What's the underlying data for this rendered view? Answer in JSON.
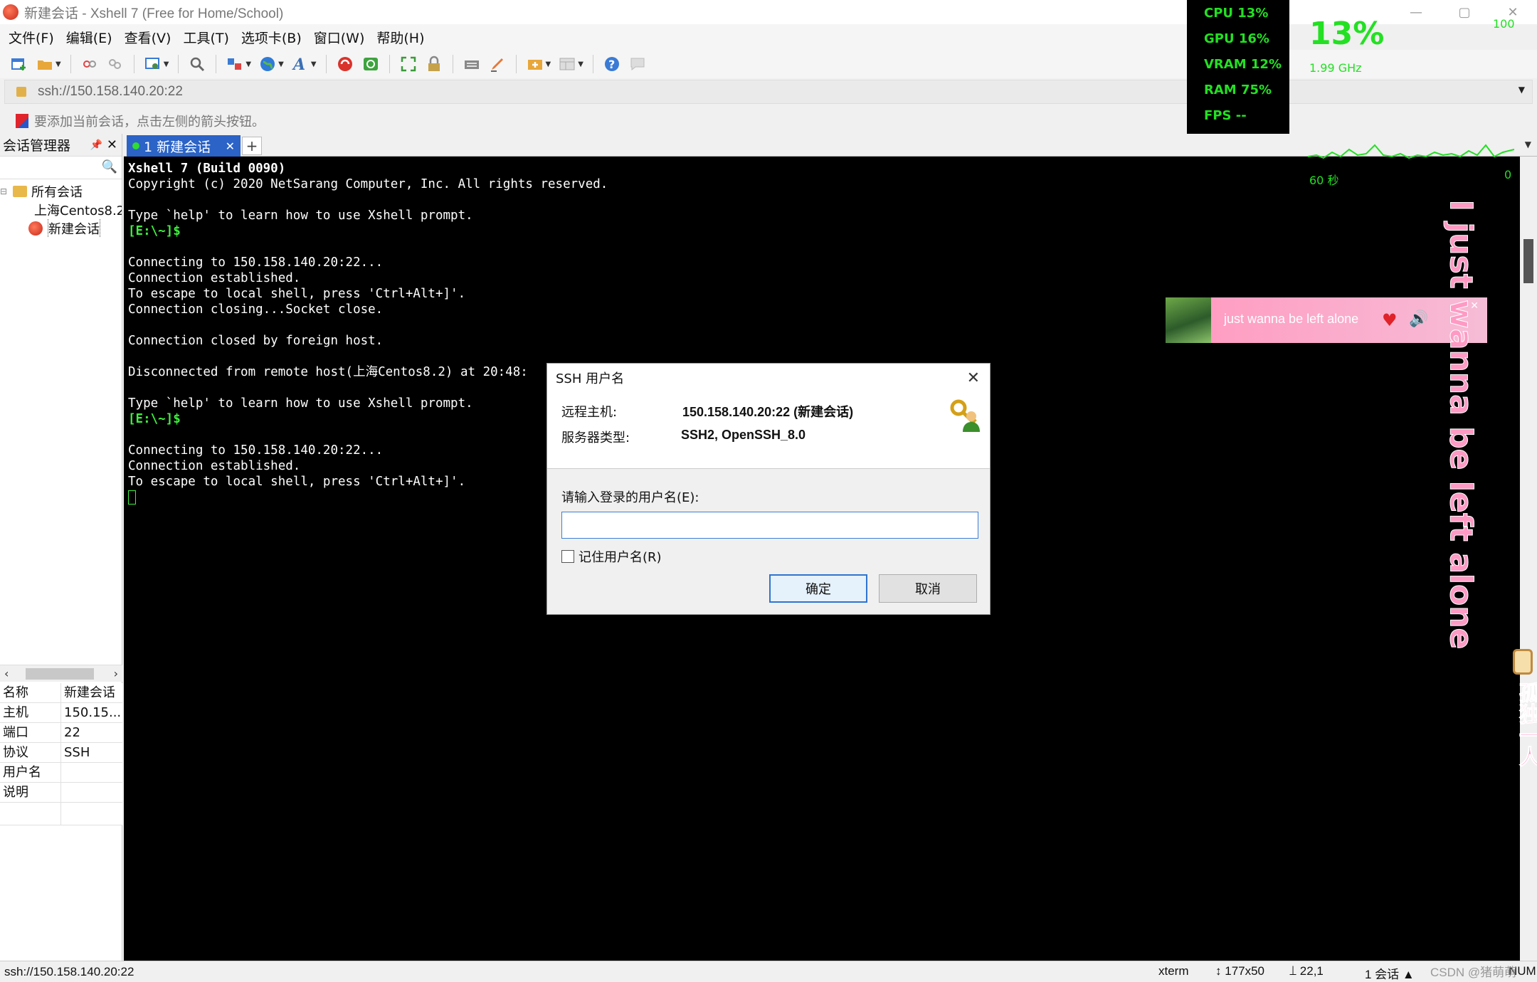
{
  "window": {
    "title": "新建会话 - Xshell 7 (Free for Home/School)",
    "minimize": "—",
    "maximize": "▢",
    "close": "✕"
  },
  "menu": [
    "文件(F)",
    "编辑(E)",
    "查看(V)",
    "工具(T)",
    "选项卡(B)",
    "窗口(W)",
    "帮助(H)"
  ],
  "toolbar": {
    "icons": [
      "new-session-icon",
      "open-folder-icon",
      "disconnect-icon",
      "reconnect-icon",
      "properties-icon",
      "find-icon",
      "transfer-icon",
      "globe-icon",
      "font-icon",
      "xshell-icon",
      "xftp-icon",
      "fullscreen-icon",
      "lock-icon",
      "keyboard-icon",
      "highlight-icon",
      "compose-icon",
      "layout-icon",
      "help-icon",
      "chat-icon"
    ]
  },
  "address": {
    "text": "ssh://150.158.140.20:22"
  },
  "hint": {
    "text": "要添加当前会话，点击左侧的箭头按钮。"
  },
  "session_manager": {
    "title": "会话管理器",
    "pin": "📌",
    "close": "✕",
    "tree": [
      {
        "label": "所有会话",
        "type": "folder"
      },
      {
        "label": "上海Centos8.2",
        "type": "session"
      },
      {
        "label": "新建会话",
        "type": "session"
      }
    ]
  },
  "properties": [
    {
      "key": "名称",
      "value": "新建会话"
    },
    {
      "key": "主机",
      "value": "150.15..."
    },
    {
      "key": "端口",
      "value": "22"
    },
    {
      "key": "协议",
      "value": "SSH"
    },
    {
      "key": "用户名",
      "value": ""
    },
    {
      "key": "说明",
      "value": ""
    }
  ],
  "tabs": [
    {
      "label": "1 新建会话",
      "active": true
    }
  ],
  "tab_add": "+",
  "terminal": {
    "lines": [
      {
        "text": "Xshell 7 (Build 0090)",
        "style": "bold"
      },
      {
        "text": "Copyright (c) 2020 NetSarang Computer, Inc. All rights reserved.",
        "style": "normal"
      },
      {
        "text": "",
        "style": "normal"
      },
      {
        "text": "Type `help' to learn how to use Xshell prompt.",
        "style": "normal"
      },
      {
        "text": "[E:\\~]$",
        "style": "prompt"
      },
      {
        "text": "",
        "style": "normal"
      },
      {
        "text": "Connecting to 150.158.140.20:22...",
        "style": "normal"
      },
      {
        "text": "Connection established.",
        "style": "normal"
      },
      {
        "text": "To escape to local shell, press 'Ctrl+Alt+]'.",
        "style": "normal"
      },
      {
        "text": "Connection closing...Socket close.",
        "style": "normal"
      },
      {
        "text": "",
        "style": "normal"
      },
      {
        "text": "Connection closed by foreign host.",
        "style": "normal"
      },
      {
        "text": "",
        "style": "normal"
      },
      {
        "text": "Disconnected from remote host(上海Centos8.2) at 20:48:",
        "style": "normal"
      },
      {
        "text": "",
        "style": "normal"
      },
      {
        "text": "Type `help' to learn how to use Xshell prompt.",
        "style": "normal"
      },
      {
        "text": "[E:\\~]$",
        "style": "prompt"
      },
      {
        "text": "",
        "style": "normal"
      },
      {
        "text": "Connecting to 150.158.140.20:22...",
        "style": "normal"
      },
      {
        "text": "Connection established.",
        "style": "normal"
      },
      {
        "text": "To escape to local shell, press 'Ctrl+Alt+]'.",
        "style": "normal"
      }
    ]
  },
  "dialog": {
    "title": "SSH 用户名",
    "remote_host_label": "远程主机:",
    "remote_host_value": "150.158.140.20:22 (新建会话)",
    "server_type_label": "服务器类型:",
    "server_type_value": "SSH2, OpenSSH_8.0",
    "prompt": "请输入登录的用户名(E):",
    "username_value": "",
    "remember_label": "记住用户名(R)",
    "ok": "确定",
    "cancel": "取消"
  },
  "statusbar": {
    "address": "ssh://150.158.140.20:22",
    "term": "xterm",
    "size": "177x50",
    "cursor": "22,1",
    "sessions": "1 会话",
    "num": "NUM"
  },
  "hw_monitor": {
    "cpu": "CPU  13%",
    "gpu": "GPU  16%",
    "vram": "VRAM  12%",
    "ram": "RAM  75%",
    "fps": "FPS --",
    "big": "13%",
    "freq": "1.99 GHz",
    "max": "100",
    "min": "0",
    "window": "60 秒",
    "color": "#23e023"
  },
  "music": {
    "song": "just wanna be left alone",
    "lyric": "I just wanna be left alone",
    "side_text": "孤独一人",
    "accent": "#ff9ec2"
  },
  "watermark": "CSDN @猪萌萌"
}
